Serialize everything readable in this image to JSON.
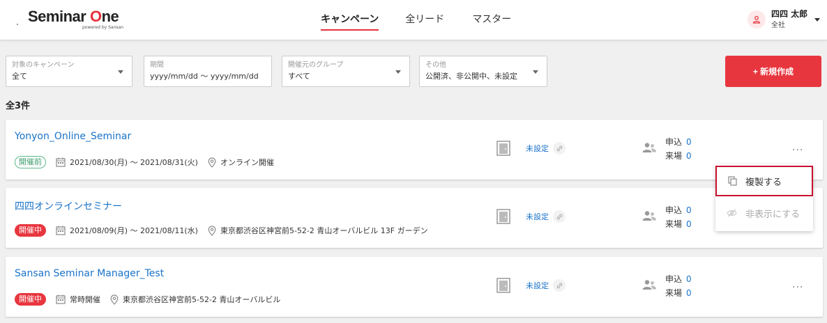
{
  "header": {
    "logo": {
      "text_a": "Seminar ",
      "text_o": "O",
      "text_b": "ne",
      "sub": "powered by Sansan"
    },
    "nav": [
      {
        "label": "キャンペーン",
        "active": true
      },
      {
        "label": "全リード",
        "active": false
      },
      {
        "label": "マスター",
        "active": false
      }
    ],
    "user": {
      "name": "四四 太郎",
      "org": "全社"
    }
  },
  "filters": [
    {
      "label": "対象のキャンペーン",
      "value": "全て",
      "dropdown": true
    },
    {
      "label": "期間",
      "value": "yyyy/mm/dd 〜 yyyy/mm/dd",
      "dropdown": false
    },
    {
      "label": "開催元のグループ",
      "value": "すべて",
      "dropdown": true
    },
    {
      "label": "その他",
      "value": "公開済、非公開中、未設定",
      "dropdown": true
    }
  ],
  "new_button": "+ 新規作成",
  "total": "全3件",
  "campaigns": [
    {
      "title": "Yonyon_Online_Seminar",
      "status": "開催前",
      "date": "2021/08/30(月) 〜 2021/08/31(火)",
      "location": "オンライン開催",
      "page_status": "未設定",
      "applications_label": "申込",
      "applications": "0",
      "visits_label": "来場",
      "visits": "0"
    },
    {
      "title": "四四オンラインセミナー",
      "status": "開催中",
      "date": "2021/08/09(月) 〜 2021/08/11(水)",
      "location": "東京都渋谷区神宮前5-52-2 青山オーバルビル 13F ガーデン",
      "page_status": "未設定",
      "applications_label": "申込",
      "applications": "0",
      "visits_label": "来場",
      "visits": "0"
    },
    {
      "title": "Sansan Seminar Manager_Test",
      "status": "開催中",
      "date": "常時開催",
      "location": "東京都渋谷区神宮前5-52-2 青山オーバルビル",
      "page_status": "未設定",
      "applications_label": "申込",
      "applications": "0",
      "visits_label": "来場",
      "visits": "0"
    }
  ],
  "menu": {
    "duplicate": "複製する",
    "hide": "非表示にする"
  },
  "colors": {
    "accent": "#e8363f",
    "link": "#1a73c9",
    "badge_before": "#3f9c6c"
  }
}
